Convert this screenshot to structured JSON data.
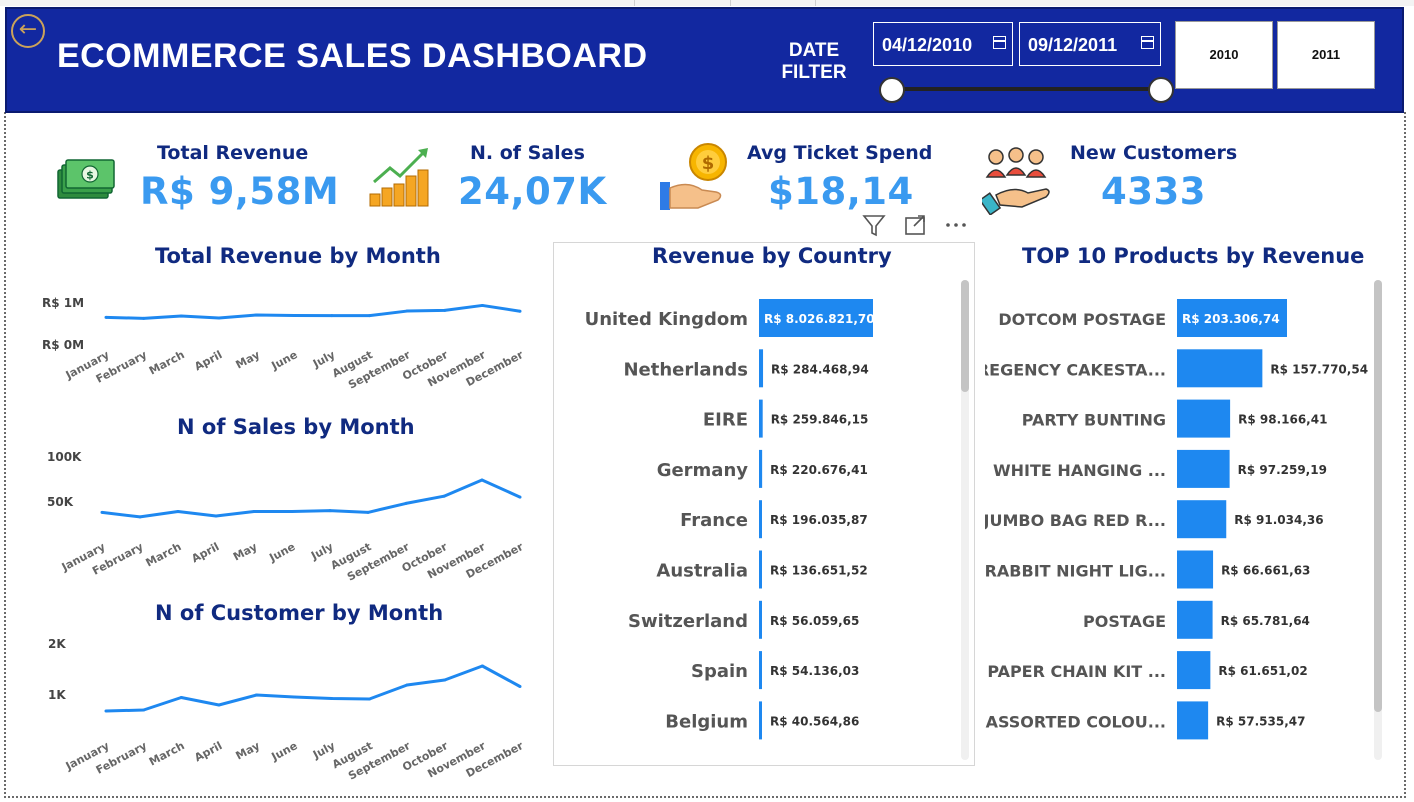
{
  "report": {
    "title": "ECOMMERCE SALES DASHBOARD",
    "date_filter_label": "DATE FILTER",
    "date_start": "04/12/2010",
    "date_end": "09/12/2011",
    "year_buttons": [
      "2010",
      "2011"
    ]
  },
  "kpis": [
    {
      "label": "Total Revenue",
      "value": "R$ 9,58M",
      "icon": "money-icon"
    },
    {
      "label": "N. of Sales",
      "value": "24,07K",
      "icon": "growth-chart-icon"
    },
    {
      "label": "Avg Ticket Spend",
      "value": "$18,14",
      "icon": "coin-hand-icon"
    },
    {
      "label": "New Customers",
      "value": "4333",
      "icon": "customers-hand-icon"
    }
  ],
  "colors": {
    "header_bg": "#1228a0",
    "accent": "#1e88f0",
    "title": "#102a80",
    "kpi_value": "#3a9af0"
  },
  "chart_data": [
    {
      "type": "line",
      "title": "Total Revenue by Month",
      "categories": [
        "January",
        "February",
        "March",
        "April",
        "May",
        "June",
        "July",
        "August",
        "September",
        "October",
        "November",
        "December"
      ],
      "values": [
        0.45,
        0.39,
        0.53,
        0.41,
        0.59,
        0.56,
        0.55,
        0.55,
        0.82,
        0.86,
        1.15,
        0.81
      ],
      "y_ticks": [
        "R$ 1M",
        "R$ 0M"
      ],
      "unit": "R$ M"
    },
    {
      "type": "line",
      "title": "N of Sales by Month",
      "categories": [
        "January",
        "February",
        "March",
        "April",
        "May",
        "June",
        "July",
        "August",
        "September",
        "October",
        "November",
        "December"
      ],
      "values": [
        34,
        29,
        35,
        30,
        35,
        35,
        36,
        34,
        44,
        52,
        70,
        51
      ],
      "y_ticks": [
        "100K",
        "50K"
      ],
      "unit": "K"
    },
    {
      "type": "line",
      "title": "N of Customer by Month",
      "categories": [
        "January",
        "February",
        "March",
        "April",
        "May",
        "June",
        "July",
        "August",
        "September",
        "October",
        "November",
        "December"
      ],
      "values": [
        0.78,
        0.8,
        1.05,
        0.9,
        1.1,
        1.06,
        1.03,
        1.02,
        1.3,
        1.4,
        1.68,
        1.27
      ],
      "y_ticks": [
        "2K",
        "1K"
      ],
      "unit": "K"
    },
    {
      "type": "bar",
      "title": "Revenue by Country",
      "categories": [
        "United Kingdom",
        "Netherlands",
        "EIRE",
        "Germany",
        "France",
        "Australia",
        "Switzerland",
        "Spain",
        "Belgium"
      ],
      "values": [
        8026821.704,
        284468.94,
        259846.15,
        220676.41,
        196035.87,
        136651.52,
        56059.65,
        54136.03,
        40564.86
      ],
      "value_labels": [
        "R$ 8.026.821,704",
        "R$ 284.468,94",
        "R$ 259.846,15",
        "R$ 220.676,41",
        "R$ 196.035,87",
        "R$ 136.651,52",
        "R$ 56.059,65",
        "R$ 54.136,03",
        "R$ 40.564,86"
      ]
    },
    {
      "type": "bar",
      "title": "TOP 10 Products by Revenue",
      "categories": [
        "DOTCOM POSTAGE",
        "REGENCY CAKESTA...",
        "PARTY BUNTING",
        "WHITE HANGING ...",
        "JUMBO BAG RED R...",
        "RABBIT NIGHT LIG...",
        "POSTAGE",
        "PAPER CHAIN KIT ...",
        "ASSORTED COLOU..."
      ],
      "values": [
        203306.74,
        157770.54,
        98166.41,
        97259.19,
        91034.36,
        66661.63,
        65781.64,
        61651.02,
        57535.47
      ],
      "value_labels": [
        "R$ 203.306,74",
        "R$ 157.770,54",
        "R$ 98.166,41",
        "R$ 97.259,19",
        "R$ 91.034,36",
        "R$ 66.661,63",
        "R$ 65.781,64",
        "R$ 61.651,02",
        "R$ 57.535,47"
      ]
    }
  ]
}
